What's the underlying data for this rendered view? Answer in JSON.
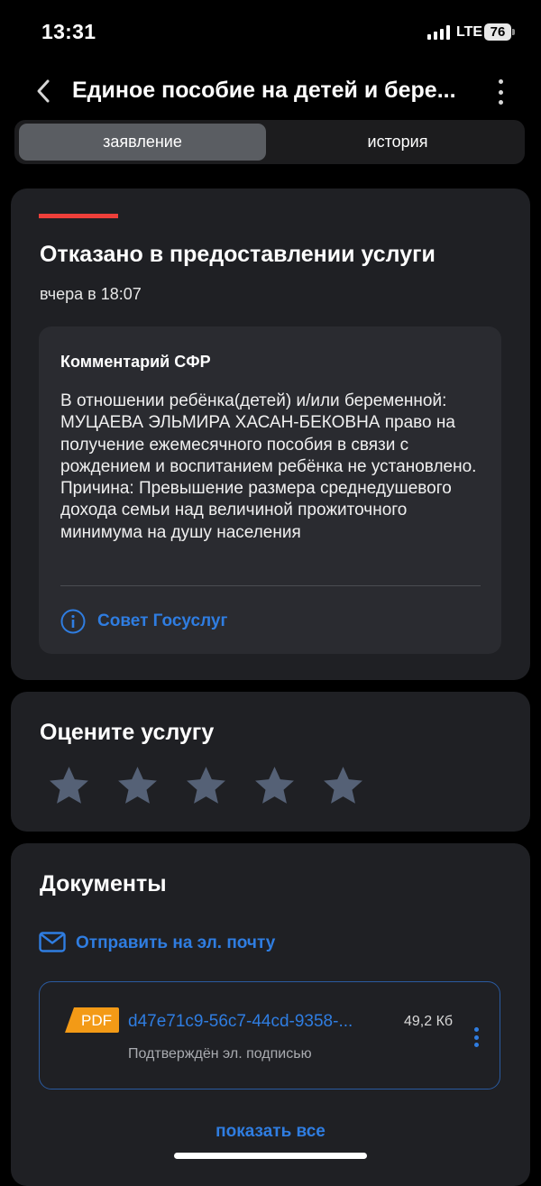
{
  "status_bar": {
    "time": "13:31",
    "network": "LTE",
    "battery": "76"
  },
  "header": {
    "title": "Единое пособие на детей и бере...",
    "back_icon": "chevron-left-icon",
    "menu_icon": "more-vertical-icon"
  },
  "tabs": [
    {
      "label": "заявление",
      "active": true
    },
    {
      "label": "история",
      "active": false
    }
  ],
  "status": {
    "title": "Отказано в предоставлении услуги",
    "time": "вчера в 18:07",
    "accent_color": "#ee3f3a"
  },
  "comment": {
    "title": "Комментарий СФР",
    "text": "В отношении ребёнка(детей) и/или беременной: МУЦАЕВА ЭЛЬМИРА ХАСАН-БЕКОВНА право на получение ежемесячного пособия в связи с рождением и воспитанием ребёнка не установлено. Причина: Превышение размера среднедушевого дохода семьи над величиной прожиточного минимума на душу населения",
    "advice_link": "Совет Госуслуг",
    "advice_icon": "info-icon"
  },
  "rating": {
    "title": "Оцените услугу",
    "stars_total": 5,
    "stars_selected": 0
  },
  "documents": {
    "title": "Документы",
    "email_link": "Отправить на эл. почту",
    "email_icon": "mail-icon",
    "file": {
      "type_badge": "PDF",
      "name": "d47e71c9-56c7-44cd-9358-...",
      "size": "49,2 Кб",
      "subtitle": "Подтверждён эл. подписью"
    },
    "show_all": "показать все"
  },
  "colors": {
    "link": "#2f7de1",
    "card": "#1f2024",
    "pdf_badge": "#f39a16"
  }
}
